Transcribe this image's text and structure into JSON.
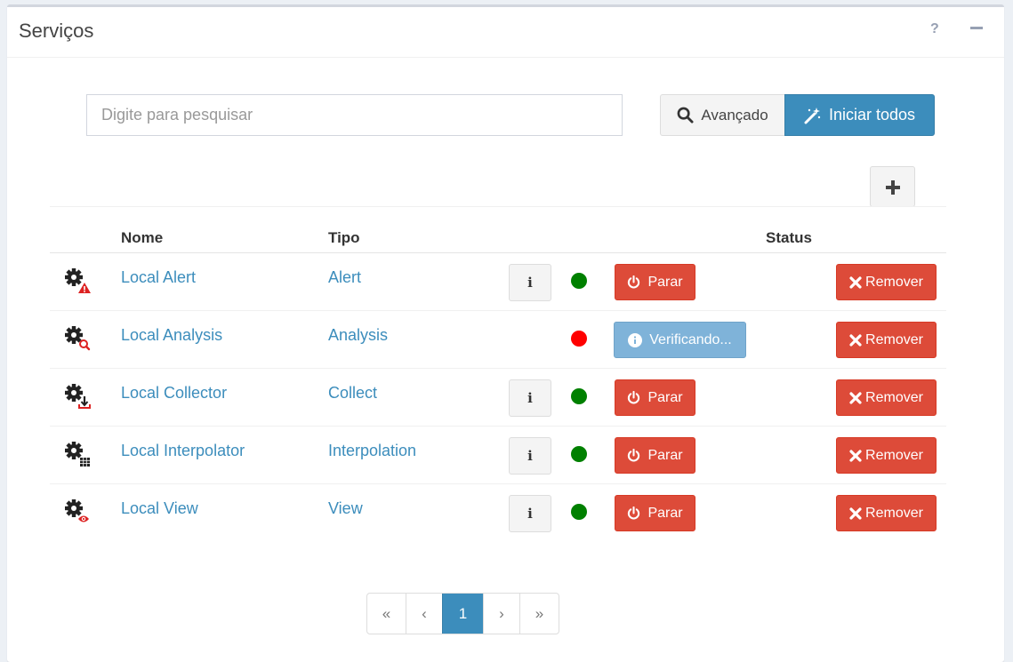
{
  "header": {
    "title": "Serviços",
    "help_label": "?",
    "minimize_label": "−"
  },
  "search": {
    "placeholder": "Digite para pesquisar",
    "value": ""
  },
  "toolbar": {
    "advanced_label": "Avançado",
    "start_all_label": "Iniciar todos",
    "add_label": "+"
  },
  "table": {
    "columns": {
      "name": "Nome",
      "type": "Tipo",
      "status": "Status"
    },
    "rows": [
      {
        "name": "Local Alert",
        "type": "Alert",
        "icon": "gear-alert-icon",
        "info": "i",
        "status_color": "#008000",
        "action_label": "Parar",
        "remove_label": "Remover"
      },
      {
        "name": "Local Analysis",
        "type": "Analysis",
        "icon": "gear-search-icon",
        "info": "",
        "status_color": "#ff0000",
        "action_label": "Verificando...",
        "remove_label": "Remover"
      },
      {
        "name": "Local Collector",
        "type": "Collect",
        "icon": "gear-download-icon",
        "info": "i",
        "status_color": "#008000",
        "action_label": "Parar",
        "remove_label": "Remover"
      },
      {
        "name": "Local Interpolator",
        "type": "Interpolation",
        "icon": "gear-grid-icon",
        "info": "i",
        "status_color": "#008000",
        "action_label": "Parar",
        "remove_label": "Remover"
      },
      {
        "name": "Local View",
        "type": "View",
        "icon": "gear-eye-icon",
        "info": "i",
        "status_color": "#008000",
        "action_label": "Parar",
        "remove_label": "Remover"
      }
    ]
  },
  "pagination": {
    "first": "«",
    "prev": "‹",
    "current": "1",
    "next": "›",
    "last": "»"
  },
  "colors": {
    "primary": "#3c8dbc",
    "danger": "#dd4b39",
    "status_ok": "#008000",
    "status_error": "#ff0000"
  }
}
